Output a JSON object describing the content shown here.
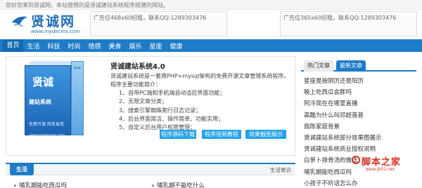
{
  "topbar": {
    "welcome": "您好您来到贤诚网，本站使用的是贤诚建站系统程序搭建的网站。"
  },
  "logo": {
    "brand": "贤诚网",
    "domain": "www.mydecms.com"
  },
  "ads": [
    {
      "text": "广告位468x60招租，联系QQ:1289303476"
    },
    {
      "text": "广告位365x60招租，联系QQ:1289303476"
    }
  ],
  "nav": {
    "active": "首页",
    "items": [
      "首页",
      "生活",
      "科技",
      "时尚",
      "情感",
      "美食",
      "娱乐",
      "星座",
      "健康"
    ]
  },
  "promo": {
    "box": {
      "title": "贤诚",
      "subtitle": "建站系统",
      "features": "免费开源  简单易用",
      "php": "PHP",
      "url": "www.mydecms.com"
    },
    "title": "贤诚建站系统4.0",
    "description": "贤诚建站系统是一套用PHP+mysql架构的免费开源文章管理系统程序。",
    "features_heading": "程序主要功能简介：",
    "features": [
      "1、自带PC端和手机端自动适应界面功能；",
      "2、无限文章分类；",
      "3、搜索引擎蜘蛛爬行日志记录；",
      "4、后台界面简洁、操作简单、功能实用；",
      "5、自定义后台用户权限管理；"
    ],
    "buttons": [
      "程序源码下载",
      "程序视频教程",
      "效果截图展示"
    ]
  },
  "sidebar": {
    "tabs": [
      "热门文章",
      "最新文章"
    ],
    "active_tab": "最新文章",
    "articles": [
      "星座是按阴历还是阳历",
      "晚上吃西瓜会胖吗",
      "阿冷现在在哪里直播",
      "高酷为什么叫邓超普普",
      "扇陈家庭背景",
      "贤诚建站系统部分效果图展示",
      "贤诚建站系统商业授权说明",
      "白萝卜排骨汤的做法",
      "哺乳期能吃西瓜吗",
      "小孩子不听话怎么办"
    ]
  },
  "section": {
    "tab": "生活",
    "more": "生活常识",
    "items": [
      "哺乳期能吃西瓜吗",
      "哺乳期不能吃什么"
    ]
  },
  "watermark": {
    "main": "脚本之家",
    "url": "www.jb51.net"
  },
  "colors": {
    "primary": "#1e7cc8",
    "button": "#24a2e8",
    "watermark": "#d6301e"
  }
}
